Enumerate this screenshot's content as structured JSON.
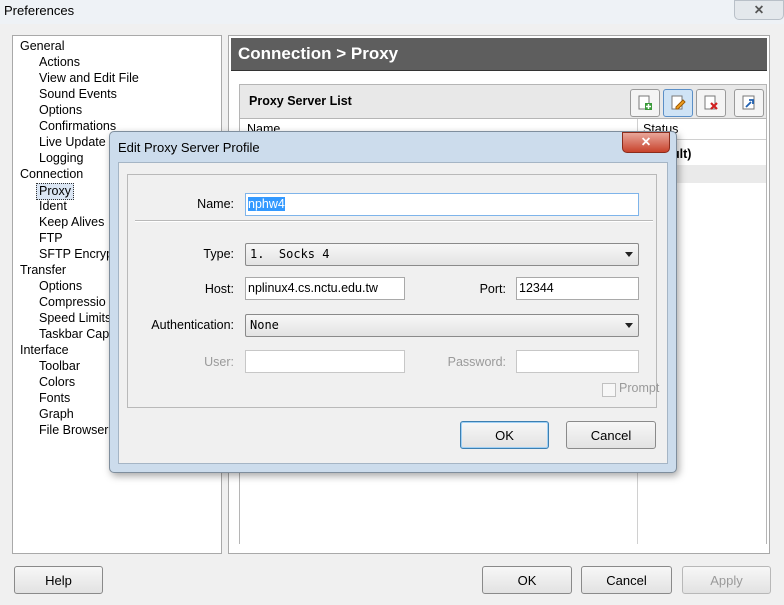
{
  "window": {
    "title": "Preferences",
    "close_glyph": "✕"
  },
  "tree": {
    "items": [
      {
        "label": "General",
        "level": 0
      },
      {
        "label": "Actions",
        "level": 1
      },
      {
        "label": "View and Edit File",
        "level": 1
      },
      {
        "label": "Sound Events",
        "level": 1
      },
      {
        "label": "Options",
        "level": 1
      },
      {
        "label": "Confirmations",
        "level": 1
      },
      {
        "label": "Live Update",
        "level": 1
      },
      {
        "label": "Logging",
        "level": 1
      },
      {
        "label": "Connection",
        "level": 0
      },
      {
        "label": "Proxy",
        "level": 1,
        "selected": true
      },
      {
        "label": "Ident",
        "level": 1
      },
      {
        "label": "Keep Alives",
        "level": 1
      },
      {
        "label": "FTP",
        "level": 1
      },
      {
        "label": "SFTP Encryp",
        "level": 1
      },
      {
        "label": "Transfer",
        "level": 0
      },
      {
        "label": "Options",
        "level": 1
      },
      {
        "label": "Compressio",
        "level": 1
      },
      {
        "label": "Speed Limits",
        "level": 1
      },
      {
        "label": "Taskbar Cap",
        "level": 1
      },
      {
        "label": "Interface",
        "level": 0
      },
      {
        "label": "Toolbar",
        "level": 1
      },
      {
        "label": "Colors",
        "level": 1
      },
      {
        "label": "Fonts",
        "level": 1
      },
      {
        "label": "Graph",
        "level": 1
      },
      {
        "label": "File Browser",
        "level": 1
      }
    ]
  },
  "panel": {
    "title": "Connection > Proxy",
    "group_title": "Proxy Server List",
    "toolbar_icons": [
      "add-icon",
      "edit-icon",
      "delete-icon",
      "pin-icon"
    ],
    "columns": {
      "name": "Name",
      "status": "Status"
    },
    "row_status": "ult)"
  },
  "dialog": {
    "title": "Edit Proxy Server Profile",
    "close_glyph": "✕",
    "name_label": "Name:",
    "name_value": "nphw4",
    "type_label": "Type:",
    "type_value": "1.  Socks 4",
    "host_label": "Host:",
    "host_value": "nplinux4.cs.nctu.edu.tw",
    "port_label": "Port:",
    "port_value": "12344",
    "auth_label": "Authentication:",
    "auth_value": "None",
    "user_label": "User:",
    "user_value": "",
    "password_label": "Password:",
    "password_value": "",
    "prompt_label": "Prompt",
    "ok_label": "OK",
    "cancel_label": "Cancel"
  },
  "buttons": {
    "help": "Help",
    "ok": "OK",
    "cancel": "Cancel",
    "apply": "Apply"
  },
  "colors": {
    "header_bg": "#5e5e5e",
    "dialog_frame": "#ccdcec",
    "selection": "#3399ff",
    "close_red": "#c8432c"
  }
}
